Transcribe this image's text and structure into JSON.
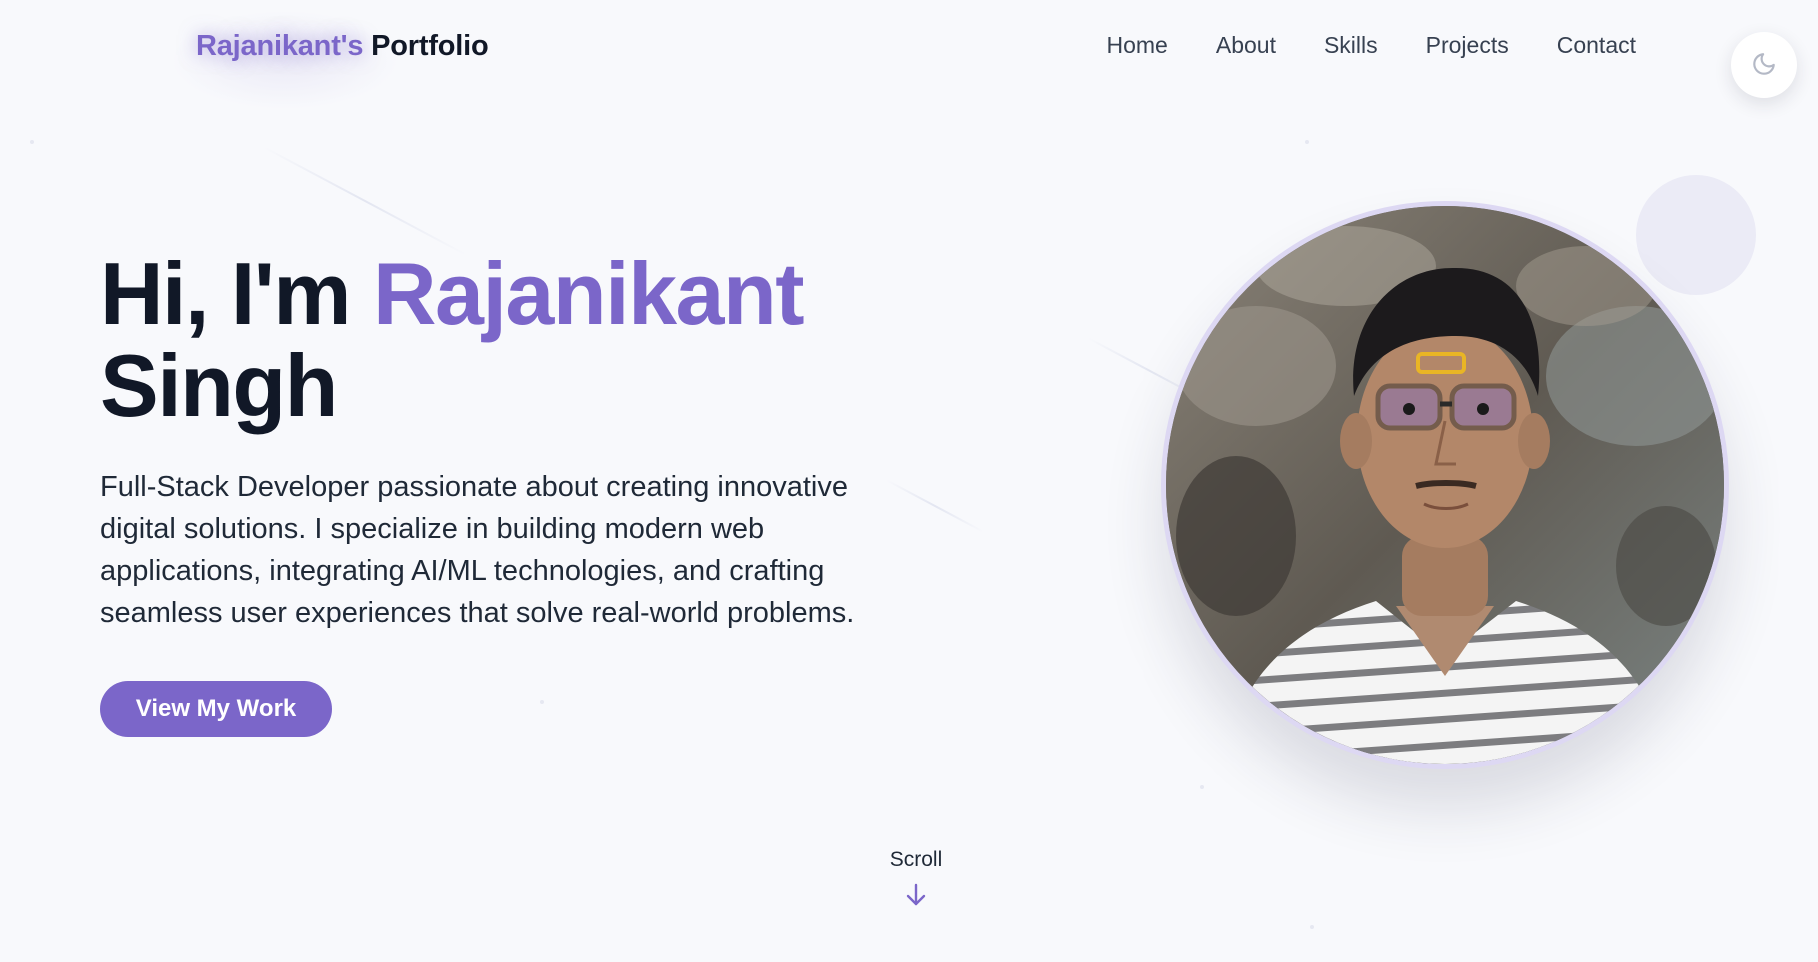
{
  "brand": {
    "highlight": "Rajanikant's",
    "rest": "Portfolio"
  },
  "nav": {
    "items": [
      {
        "label": "Home"
      },
      {
        "label": "About"
      },
      {
        "label": "Skills"
      },
      {
        "label": "Projects"
      },
      {
        "label": "Contact"
      }
    ]
  },
  "theme_toggle": {
    "icon": "moon-icon"
  },
  "hero": {
    "greeting": "Hi, I'm",
    "first_name": "Rajanikant",
    "last_name": "Singh",
    "description": "Full-Stack Developer passionate about creating innovative digital solutions. I specialize in building modern web applications, integrating AI/ML technologies, and crafting seamless user experiences that solve real-world problems.",
    "cta_label": "View My Work"
  },
  "scroll": {
    "label": "Scroll",
    "icon": "arrow-down-icon"
  },
  "colors": {
    "accent": "#7b66c9",
    "text": "#111827",
    "background": "#f8f9fc"
  }
}
